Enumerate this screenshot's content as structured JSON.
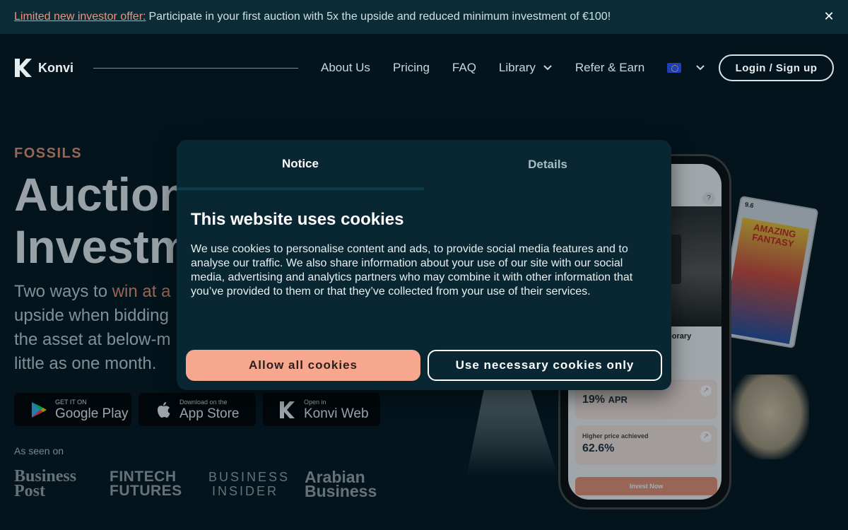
{
  "banner": {
    "offer_link": "Limited new investor offer:",
    "message": "Participate in your first auction with 5x the upside and reduced minimum investment of €100!",
    "close_icon": "close-icon"
  },
  "nav": {
    "brand": "Konvi",
    "links": [
      "About Us",
      "Pricing",
      "FAQ",
      "Library",
      "Refer & Earn"
    ],
    "login": "Login / Sign up",
    "language_icon": "eu-flag-icon"
  },
  "hero": {
    "category": "FOSSILS",
    "title_line1": "Auction",
    "title_line2": "Investm",
    "sub_before": "Two ways to ",
    "sub_accent": "win at a",
    "sub_line2": "upside when bidding",
    "sub_line3": "the asset at below-m",
    "sub_line4": "little as one month."
  },
  "stores": [
    {
      "small": "GET IT ON",
      "big": "Google Play",
      "icon": "google-play-icon"
    },
    {
      "small": "Download on the",
      "big": "App Store",
      "icon": "apple-icon"
    },
    {
      "small": "Open in",
      "big": "Konvi Web",
      "icon": "konvi-icon"
    }
  ],
  "seen_on": {
    "label": "As seen on",
    "outlets": [
      {
        "line1": "Business",
        "line2": "Post"
      },
      {
        "line1": "FINTECH",
        "line2": "FUTURES"
      },
      {
        "line1": "BUSINESS",
        "line2": "INSIDER"
      },
      {
        "line1": "Arabian",
        "line2": "Business"
      }
    ]
  },
  "phone": {
    "card_title": "porary",
    "apr_value": "19%",
    "apr_label": "APR",
    "price_label": "Higher price achieved",
    "price_value": "62.6%",
    "invest": "Invest Now",
    "help": "?"
  },
  "comic": {
    "title": "AMAZING FANTASY",
    "grade": "9.6"
  },
  "cookie": {
    "tab_notice": "Notice",
    "tab_details": "Details",
    "heading": "This website uses cookies",
    "body": "We use cookies to personalise content and ads, to provide social media features and to analyse our traffic. We also share information about your use of our site with our social media, advertising and analytics partners who may combine it with other information that you’ve provided to them or that they’ve collected from your use of their services.",
    "allow_all": "Allow all cookies",
    "necessary_only": "Use necessary cookies only"
  },
  "colors": {
    "background": "#04141d",
    "banner": "#0b2c36",
    "accent": "#e79377",
    "modal": "#082733",
    "allow_button": "#f7a78e"
  }
}
